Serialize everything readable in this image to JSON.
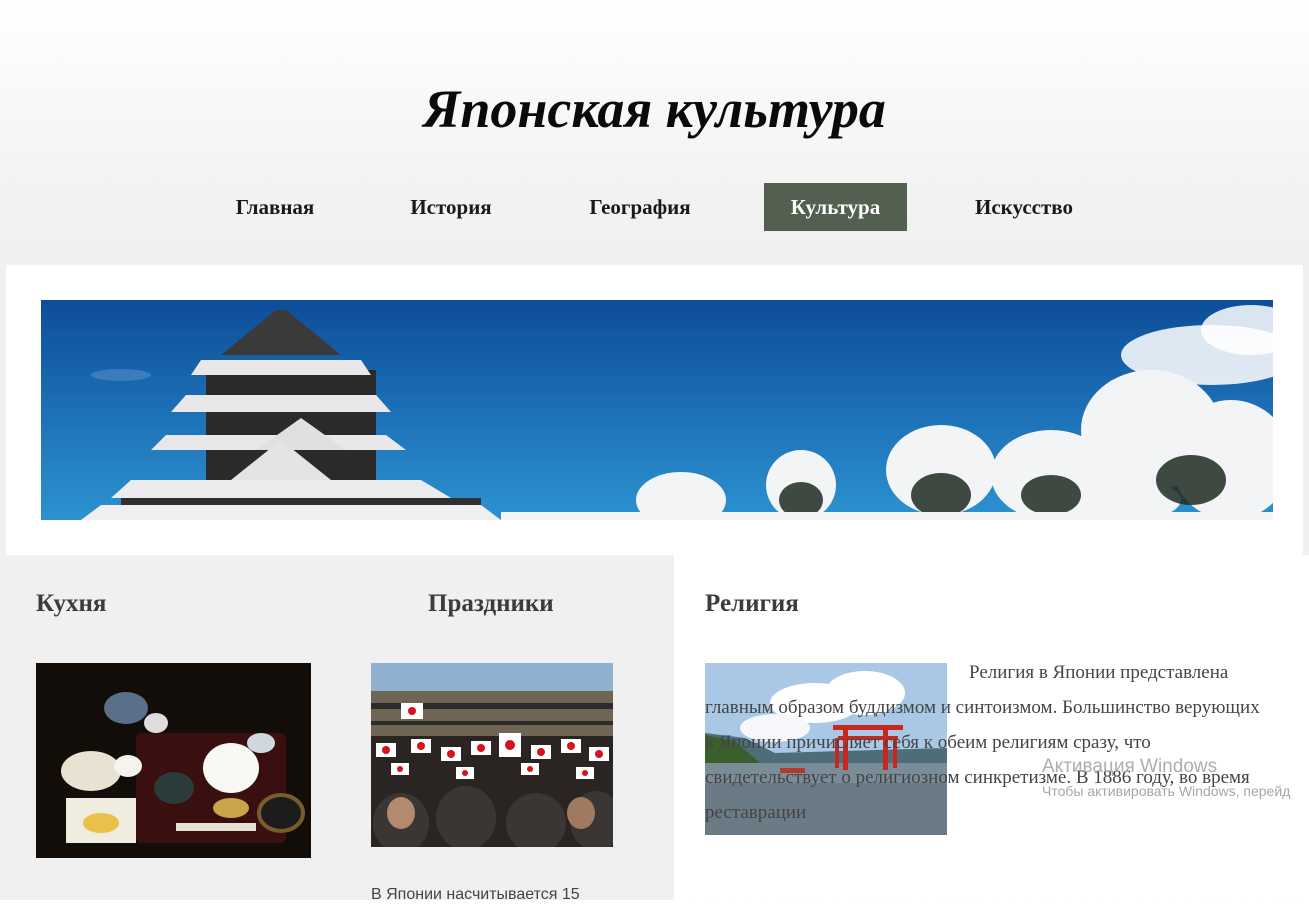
{
  "header": {
    "title": "Японская культура"
  },
  "nav": {
    "items": [
      {
        "label": "Главная",
        "active": false
      },
      {
        "label": "История",
        "active": false
      },
      {
        "label": "География",
        "active": false
      },
      {
        "label": "Культура",
        "active": true
      },
      {
        "label": "Искусство",
        "active": false
      }
    ],
    "active_color": "#535f4f"
  },
  "sections": {
    "cuisine": {
      "title": "Кухня"
    },
    "holidays": {
      "title": "Праздники",
      "text": "В Японии насчитывается 15"
    },
    "religion": {
      "title": "Религия",
      "text": "Религия в Японии представлена главным образом буддизмом и синтоизмом. Большинство верующих в Японии причисляет себя к обеим религиям сразу, что свидетельствует о религиозном синкретизме. В 1886 году, во время реставрации"
    }
  },
  "images": {
    "banner": "japanese-castle-snow-banner",
    "cuisine": "japanese-meal-tray-photo",
    "holidays": "crowd-waving-japanese-flags-photo",
    "religion": "itsukushima-torii-gate-photo"
  },
  "watermark": {
    "title": "Активация Windows",
    "subtitle": "Чтобы активировать Windows, перейд"
  }
}
